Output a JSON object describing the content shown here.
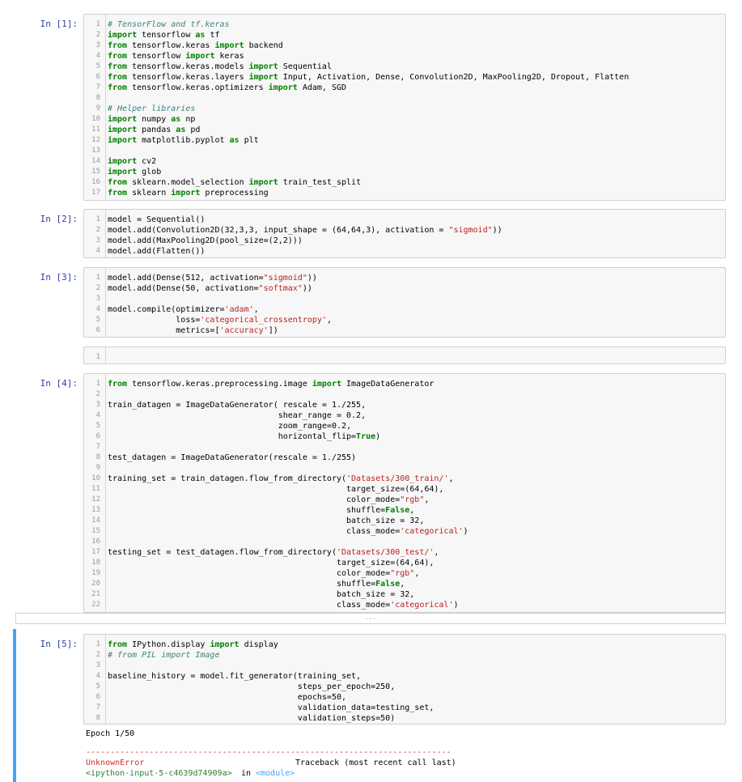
{
  "cells": [
    {
      "prompt": "In [1]:",
      "lines": [
        "# TensorFlow and tf.keras",
        "import tensorflow as tf",
        "from tensorflow.keras import backend",
        "from tensorflow import keras",
        "from tensorflow.keras.models import Sequential",
        "from tensorflow.keras.layers import Input, Activation, Dense, Convolution2D, MaxPooling2D, Dropout, Flatten",
        "from tensorflow.keras.optimizers import Adam, SGD",
        "",
        "# Helper libraries",
        "import numpy as np",
        "import pandas as pd",
        "import matplotlib.pyplot as plt",
        "",
        "import cv2",
        "import glob",
        "from sklearn.model_selection import train_test_split",
        "from sklearn import preprocessing"
      ]
    },
    {
      "prompt": "In [2]:",
      "lines": [
        "model = Sequential()",
        "model.add(Convolution2D(32,3,3, input_shape = (64,64,3), activation = \"sigmoid\"))",
        "model.add(MaxPooling2D(pool_size=(2,2)))",
        "model.add(Flatten())"
      ]
    },
    {
      "prompt": "In [3]:",
      "lines": [
        "model.add(Dense(512, activation=\"sigmoid\"))",
        "model.add(Dense(50, activation=\"softmax\"))",
        "",
        "model.compile(optimizer='adam',",
        "              loss='categorical_crossentropy',",
        "              metrics=['accuracy'])"
      ]
    },
    {
      "prompt": "",
      "lines": [
        ""
      ]
    },
    {
      "prompt": "In [4]:",
      "lines": [
        "from tensorflow.keras.preprocessing.image import ImageDataGenerator",
        "",
        "train_datagen = ImageDataGenerator( rescale = 1./255,",
        "                                   shear_range = 0.2,",
        "                                   zoom_range=0.2,",
        "                                   horizontal_flip=True)",
        "",
        "test_datagen = ImageDataGenerator(rescale = 1./255)",
        "",
        "training_set = train_datagen.flow_from_directory('Datasets/300_train/',",
        "                                                 target_size=(64,64),",
        "                                                 color_mode=\"rgb\",",
        "                                                 shuffle=False,",
        "                                                 batch_size = 32,",
        "                                                 class_mode='categorical')",
        "",
        "testing_set = test_datagen.flow_from_directory('Datasets/300_test/',",
        "                                               target_size=(64,64),",
        "                                               color_mode=\"rgb\",",
        "                                               shuffle=False,",
        "                                               batch_size = 32,",
        "                                               class_mode='categorical')"
      ]
    },
    {
      "prompt": "In [5]:",
      "lines": [
        "from IPython.display import display",
        "# from PIL import Image",
        "",
        "baseline_history = model.fit_generator(training_set,",
        "                                       steps_per_epoch=250,",
        "                                       epochs=50,",
        "                                       validation_data=testing_set,",
        "                                       validation_steps=50)"
      ]
    }
  ],
  "collapsed_marker": "...",
  "output": {
    "epoch": "Epoch 1/50",
    "dashes": "---------------------------------------------------------------------------",
    "error_name": "UnknownError",
    "traceback": "Traceback (most recent call last)",
    "location": "<ipython-input-5-c4639d74909a>",
    "in_word": "in",
    "module": "<module>"
  },
  "colors": {
    "prompt": "#303f9f",
    "selected_bar": "#42a5f5",
    "error": "#d32f2f"
  }
}
